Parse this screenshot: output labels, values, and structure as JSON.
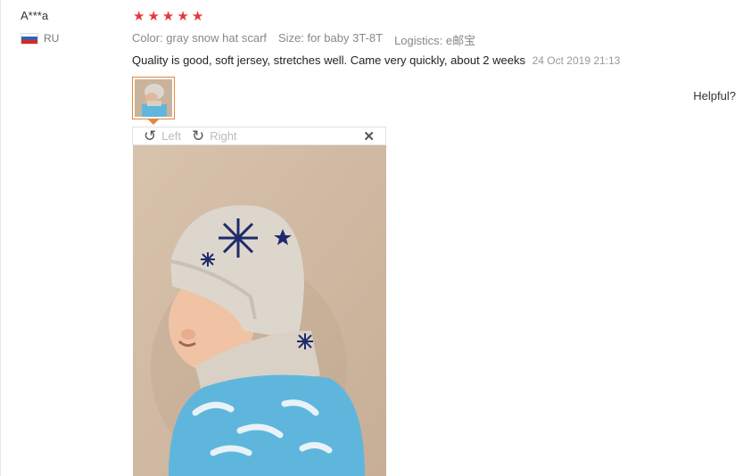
{
  "review": {
    "user_name": "A***a",
    "country": "RU",
    "rating": 5,
    "stars": [
      "★",
      "★",
      "★",
      "★",
      "★"
    ],
    "color_attr": "Color: gray snow hat scarf",
    "size_attr": "Size: for baby 3T-8T",
    "logistics_attr": "Logistics: e邮宝",
    "text": "Quality is good, soft jersey, stretches well. Came very quickly, about 2 weeks",
    "date": "24 Oct 2019 21:13",
    "helpful_label": "Helpful?"
  },
  "viewer": {
    "rotate_left_label": "Left",
    "rotate_right_label": "Right",
    "close_icon": "close-icon",
    "rotate_left_icon": "rotate-left-icon",
    "rotate_right_icon": "rotate-right-icon"
  },
  "colors": {
    "star": "#e4393c",
    "thumb_border": "#e4863c",
    "meta_text": "#888888",
    "flag_white": "#ffffff",
    "flag_blue": "#3b5db5",
    "flag_red": "#d52b1e"
  }
}
